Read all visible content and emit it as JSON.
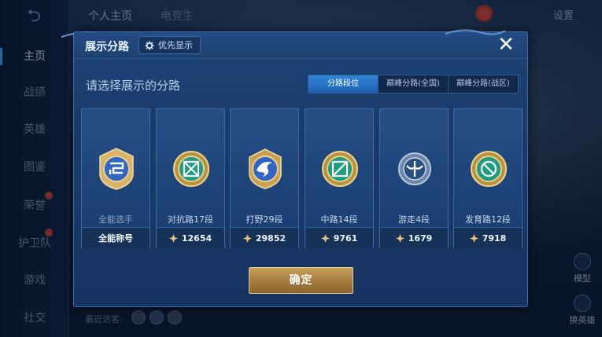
{
  "background": {
    "sidebar": {
      "items": [
        {
          "label": "主页",
          "active": true
        },
        {
          "label": "战绩",
          "active": false
        },
        {
          "label": "英雄",
          "active": false
        },
        {
          "label": "图鉴",
          "active": false
        },
        {
          "label": "荣誉",
          "active": false
        },
        {
          "label": "护卫队",
          "active": false
        },
        {
          "label": "游戏",
          "active": false
        },
        {
          "label": "社交",
          "active": false
        }
      ]
    },
    "top_tabs": [
      "个人主页",
      "电竞生"
    ],
    "settings_label": "设置",
    "right_buttons": [
      "模型",
      "换英雄"
    ],
    "recent_visitors_label": "最近访客:"
  },
  "dialog": {
    "title": "展示分路",
    "priority_button_label": "优先显示",
    "close_label": "✕",
    "subtitle": "请选择展示的分路",
    "tabs": [
      {
        "label": "分路段位",
        "active": true
      },
      {
        "label": "巅峰分路(全国)",
        "active": false
      },
      {
        "label": "巅峰分路(战区)",
        "active": false
      }
    ],
    "cards": [
      {
        "label": "全能选手",
        "footer": "全能称号",
        "has_coin": false,
        "emblem": "all-round-emblem-icon",
        "accent": "#3c7ad8"
      },
      {
        "label": "对抗路17段",
        "footer": "12654",
        "has_coin": true,
        "emblem": "clash-lane-emblem-icon",
        "accent": "#27b89a"
      },
      {
        "label": "打野29段",
        "footer": "29852",
        "has_coin": true,
        "emblem": "jungle-emblem-icon",
        "accent": "#3c7ad8"
      },
      {
        "label": "中路14段",
        "footer": "9761",
        "has_coin": true,
        "emblem": "mid-lane-emblem-icon",
        "accent": "#27b89a"
      },
      {
        "label": "游走4段",
        "footer": "1679",
        "has_coin": true,
        "emblem": "roam-emblem-icon",
        "accent": "#8aa4c4"
      },
      {
        "label": "发育路12段",
        "footer": "7918",
        "has_coin": true,
        "emblem": "farm-lane-emblem-icon",
        "accent": "#27b89a"
      }
    ],
    "confirm_label": "确定"
  },
  "colors": {
    "accent_blue": "#2f85d8",
    "gold": "#c7a05c",
    "teal": "#27b89a"
  }
}
